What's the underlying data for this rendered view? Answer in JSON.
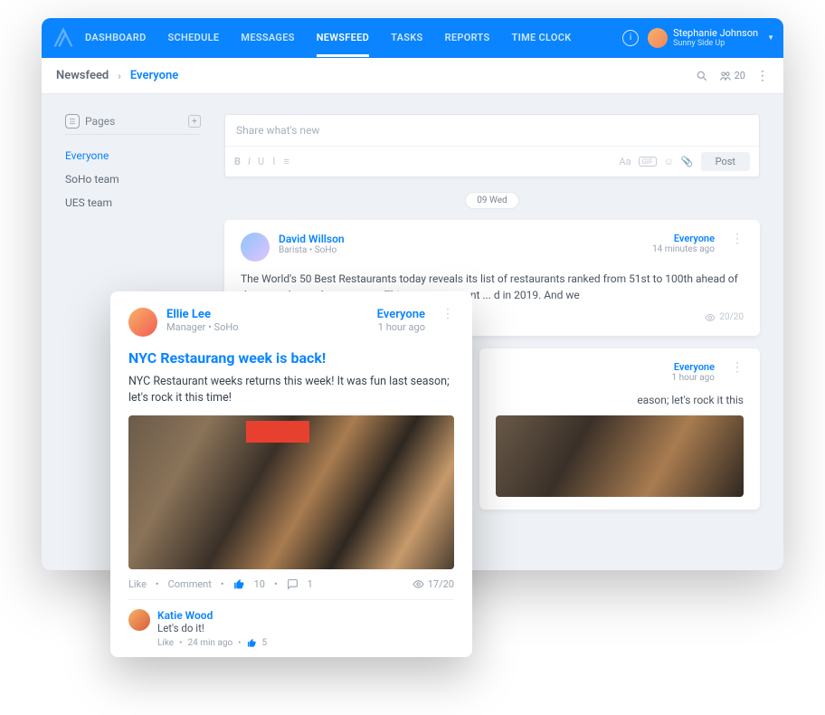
{
  "nav": {
    "tabs": [
      "DASHBOARD",
      "SCHEDULE",
      "MESSAGES",
      "NEWSFEED",
      "TASKS",
      "REPORTS",
      "TIME CLOCK"
    ],
    "active": "NEWSFEED"
  },
  "user": {
    "name": "Stephanie Johnson",
    "org": "Sunny Side Up"
  },
  "breadcrumb": {
    "root": "Newsfeed",
    "current": "Everyone",
    "count": "20"
  },
  "sidebar": {
    "title": "Pages",
    "items": [
      "Everyone",
      "SoHo team",
      "UES team"
    ],
    "activeIndex": 0
  },
  "composer": {
    "placeholder": "Share what's new",
    "post_label": "Post",
    "aa": "Aa"
  },
  "date_label": "09 Wed",
  "posts": [
    {
      "author": "David Willson",
      "role": "Barista • SoHo",
      "audience": "Everyone",
      "time": "14 minutes ago",
      "body": "The World's 50 Best Restaurants today reveals its list of restaurants ranked from 51st to 100th ahead of the annual awards ceremony. This announcement ... d in 2019. And we",
      "views": "20/20"
    },
    {
      "audience": "Everyone",
      "time": "1 hour ago",
      "snippet": "eason; let's rock it this"
    }
  ],
  "overlay": {
    "author": "Ellie Lee",
    "role": "Manager • SoHo",
    "audience": "Everyone",
    "time": "1 hour ago",
    "title": "NYC Restaurang week is back!",
    "body": "NYC Restaurant weeks returns this week! It was fun last season; let's rock it this time!",
    "like_label": "Like",
    "comment_label": "Comment",
    "likes": "10",
    "comments": "1",
    "views": "17/20",
    "comment": {
      "author": "Katie Wood",
      "text": "Let's do it!",
      "like_label": "Like",
      "ago": "24 min ago",
      "likes": "5"
    }
  }
}
